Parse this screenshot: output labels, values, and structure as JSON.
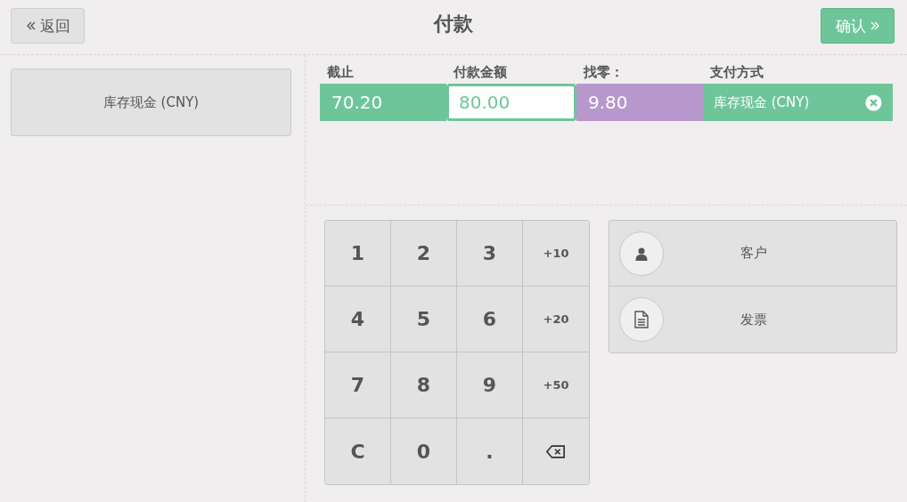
{
  "header": {
    "back_button": "返回",
    "title": "付款",
    "confirm_button": "确认"
  },
  "payment_methods": [
    {
      "label": "库存现金 (CNY)"
    }
  ],
  "payment_lines": {
    "columns": [
      "截止",
      "付款金额",
      "找零：",
      "支付方式"
    ],
    "rows": [
      {
        "due": "70.20",
        "tendered": "80.00",
        "change": "9.80",
        "method": "库存现金 (CNY)",
        "selected": true
      }
    ]
  },
  "numpad": [
    {
      "kind": "digit",
      "label": "1"
    },
    {
      "kind": "digit",
      "label": "2"
    },
    {
      "kind": "digit",
      "label": "3"
    },
    {
      "kind": "small",
      "label": "+10"
    },
    {
      "kind": "digit",
      "label": "4"
    },
    {
      "kind": "digit",
      "label": "5"
    },
    {
      "kind": "digit",
      "label": "6"
    },
    {
      "kind": "small",
      "label": "+20"
    },
    {
      "kind": "digit",
      "label": "7"
    },
    {
      "kind": "digit",
      "label": "8"
    },
    {
      "kind": "digit",
      "label": "9"
    },
    {
      "kind": "small",
      "label": "+50"
    },
    {
      "kind": "digit",
      "label": "C"
    },
    {
      "kind": "digit",
      "label": "0"
    },
    {
      "kind": "digit",
      "label": "."
    },
    {
      "kind": "backspace"
    }
  ],
  "actions": [
    {
      "kind": "customer",
      "label": "客户"
    },
    {
      "kind": "invoice",
      "label": "发票"
    }
  ]
}
